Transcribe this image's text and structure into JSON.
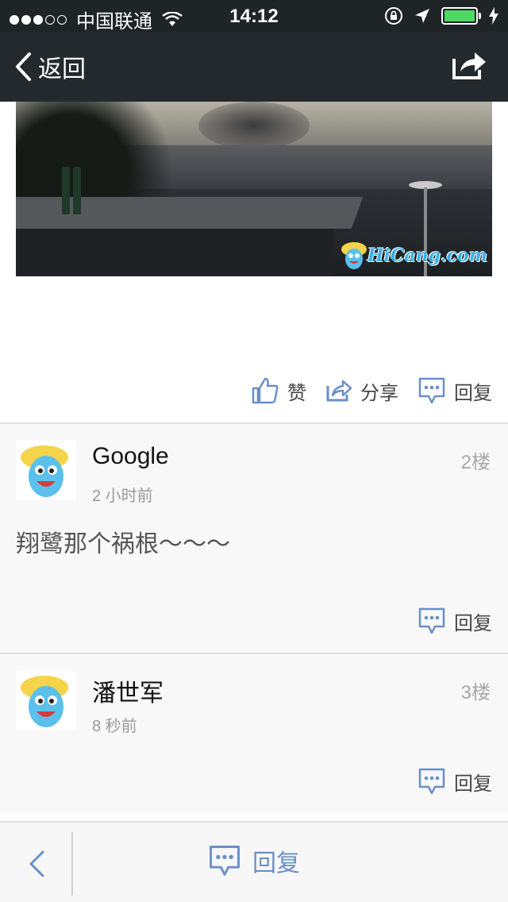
{
  "status_bar": {
    "carrier": "中国联通",
    "time": "14:12"
  },
  "nav": {
    "back_label": "返回"
  },
  "post_actions": {
    "like_label": "赞",
    "share_label": "分享",
    "reply_label": "回复"
  },
  "photo": {
    "watermark": "HiCang.com"
  },
  "comments": [
    {
      "name": "Google",
      "time": "2 小时前",
      "floor": "2楼",
      "text": "翔鹭那个祸根～～～",
      "reply_label": "回复"
    },
    {
      "name": "潘世军",
      "time": "8 秒前",
      "floor": "3楼",
      "text": "",
      "reply_label": "回复"
    }
  ],
  "bottom_bar": {
    "reply_label": "回复"
  },
  "colors": {
    "nav_bg": "#23292c",
    "accent_blue": "#6a8fc9",
    "battery_green": "#4cd964"
  }
}
